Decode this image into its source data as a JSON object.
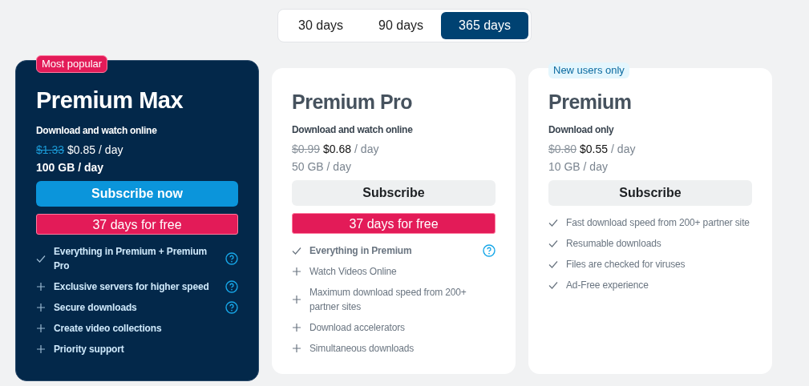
{
  "period_tabs": [
    {
      "label": "30 days",
      "selected": false
    },
    {
      "label": "90 days",
      "selected": false
    },
    {
      "label": "365 days",
      "selected": true
    }
  ],
  "plans": [
    {
      "featured": true,
      "badge": {
        "text": "Most popular",
        "kind": "popular"
      },
      "name": "Premium Max",
      "subtitle": "Download and watch online",
      "old_price": "$1.33",
      "price": "$0.85",
      "per": "/ day",
      "quota": "100 GB / day",
      "button": "Subscribe now",
      "promo": "37 days for free",
      "features": [
        {
          "kind": "check",
          "text": "Everything in Premium + Premium Pro",
          "emphasis": true,
          "info": true
        },
        {
          "kind": "plus",
          "text": "Exclusive servers for higher speed",
          "emphasis": true,
          "info": true
        },
        {
          "kind": "plus",
          "text": "Secure downloads",
          "emphasis": true,
          "info": true
        },
        {
          "kind": "plus",
          "text": "Create video collections",
          "emphasis": true,
          "info": false
        },
        {
          "kind": "plus",
          "text": "Priority support",
          "emphasis": true,
          "info": false
        }
      ]
    },
    {
      "featured": false,
      "name": "Premium Pro",
      "subtitle": "Download and watch online",
      "old_price": "$0.99",
      "price": "$0.68",
      "per": "/ day",
      "quota": "50 GB / day",
      "button": "Subscribe",
      "promo": "37 days for free",
      "features": [
        {
          "kind": "check",
          "text": "Everything in Premium",
          "emphasis": true,
          "info": true
        },
        {
          "kind": "plus",
          "text": "Watch Videos Online",
          "emphasis": false,
          "info": false
        },
        {
          "kind": "plus",
          "text": "Maximum download speed from 200+ partner sites",
          "emphasis": false,
          "info": false
        },
        {
          "kind": "plus",
          "text": "Download accelerators",
          "emphasis": false,
          "info": false
        },
        {
          "kind": "plus",
          "text": "Simultaneous downloads",
          "emphasis": false,
          "info": false
        }
      ]
    },
    {
      "featured": false,
      "badge": {
        "text": "New users only",
        "kind": "new"
      },
      "name": "Premium",
      "subtitle": "Download only",
      "old_price": "$0.80",
      "price": "$0.55",
      "per": "/ day",
      "quota": "10 GB / day",
      "button": "Subscribe",
      "features": [
        {
          "kind": "check",
          "text": "Fast download speed from 200+ partner site",
          "emphasis": false,
          "info": false
        },
        {
          "kind": "check",
          "text": "Resumable downloads",
          "emphasis": false,
          "info": false
        },
        {
          "kind": "check",
          "text": "Files are checked for viruses",
          "emphasis": false,
          "info": false
        },
        {
          "kind": "check",
          "text": "Ad-Free experience",
          "emphasis": false,
          "info": false
        }
      ]
    }
  ]
}
